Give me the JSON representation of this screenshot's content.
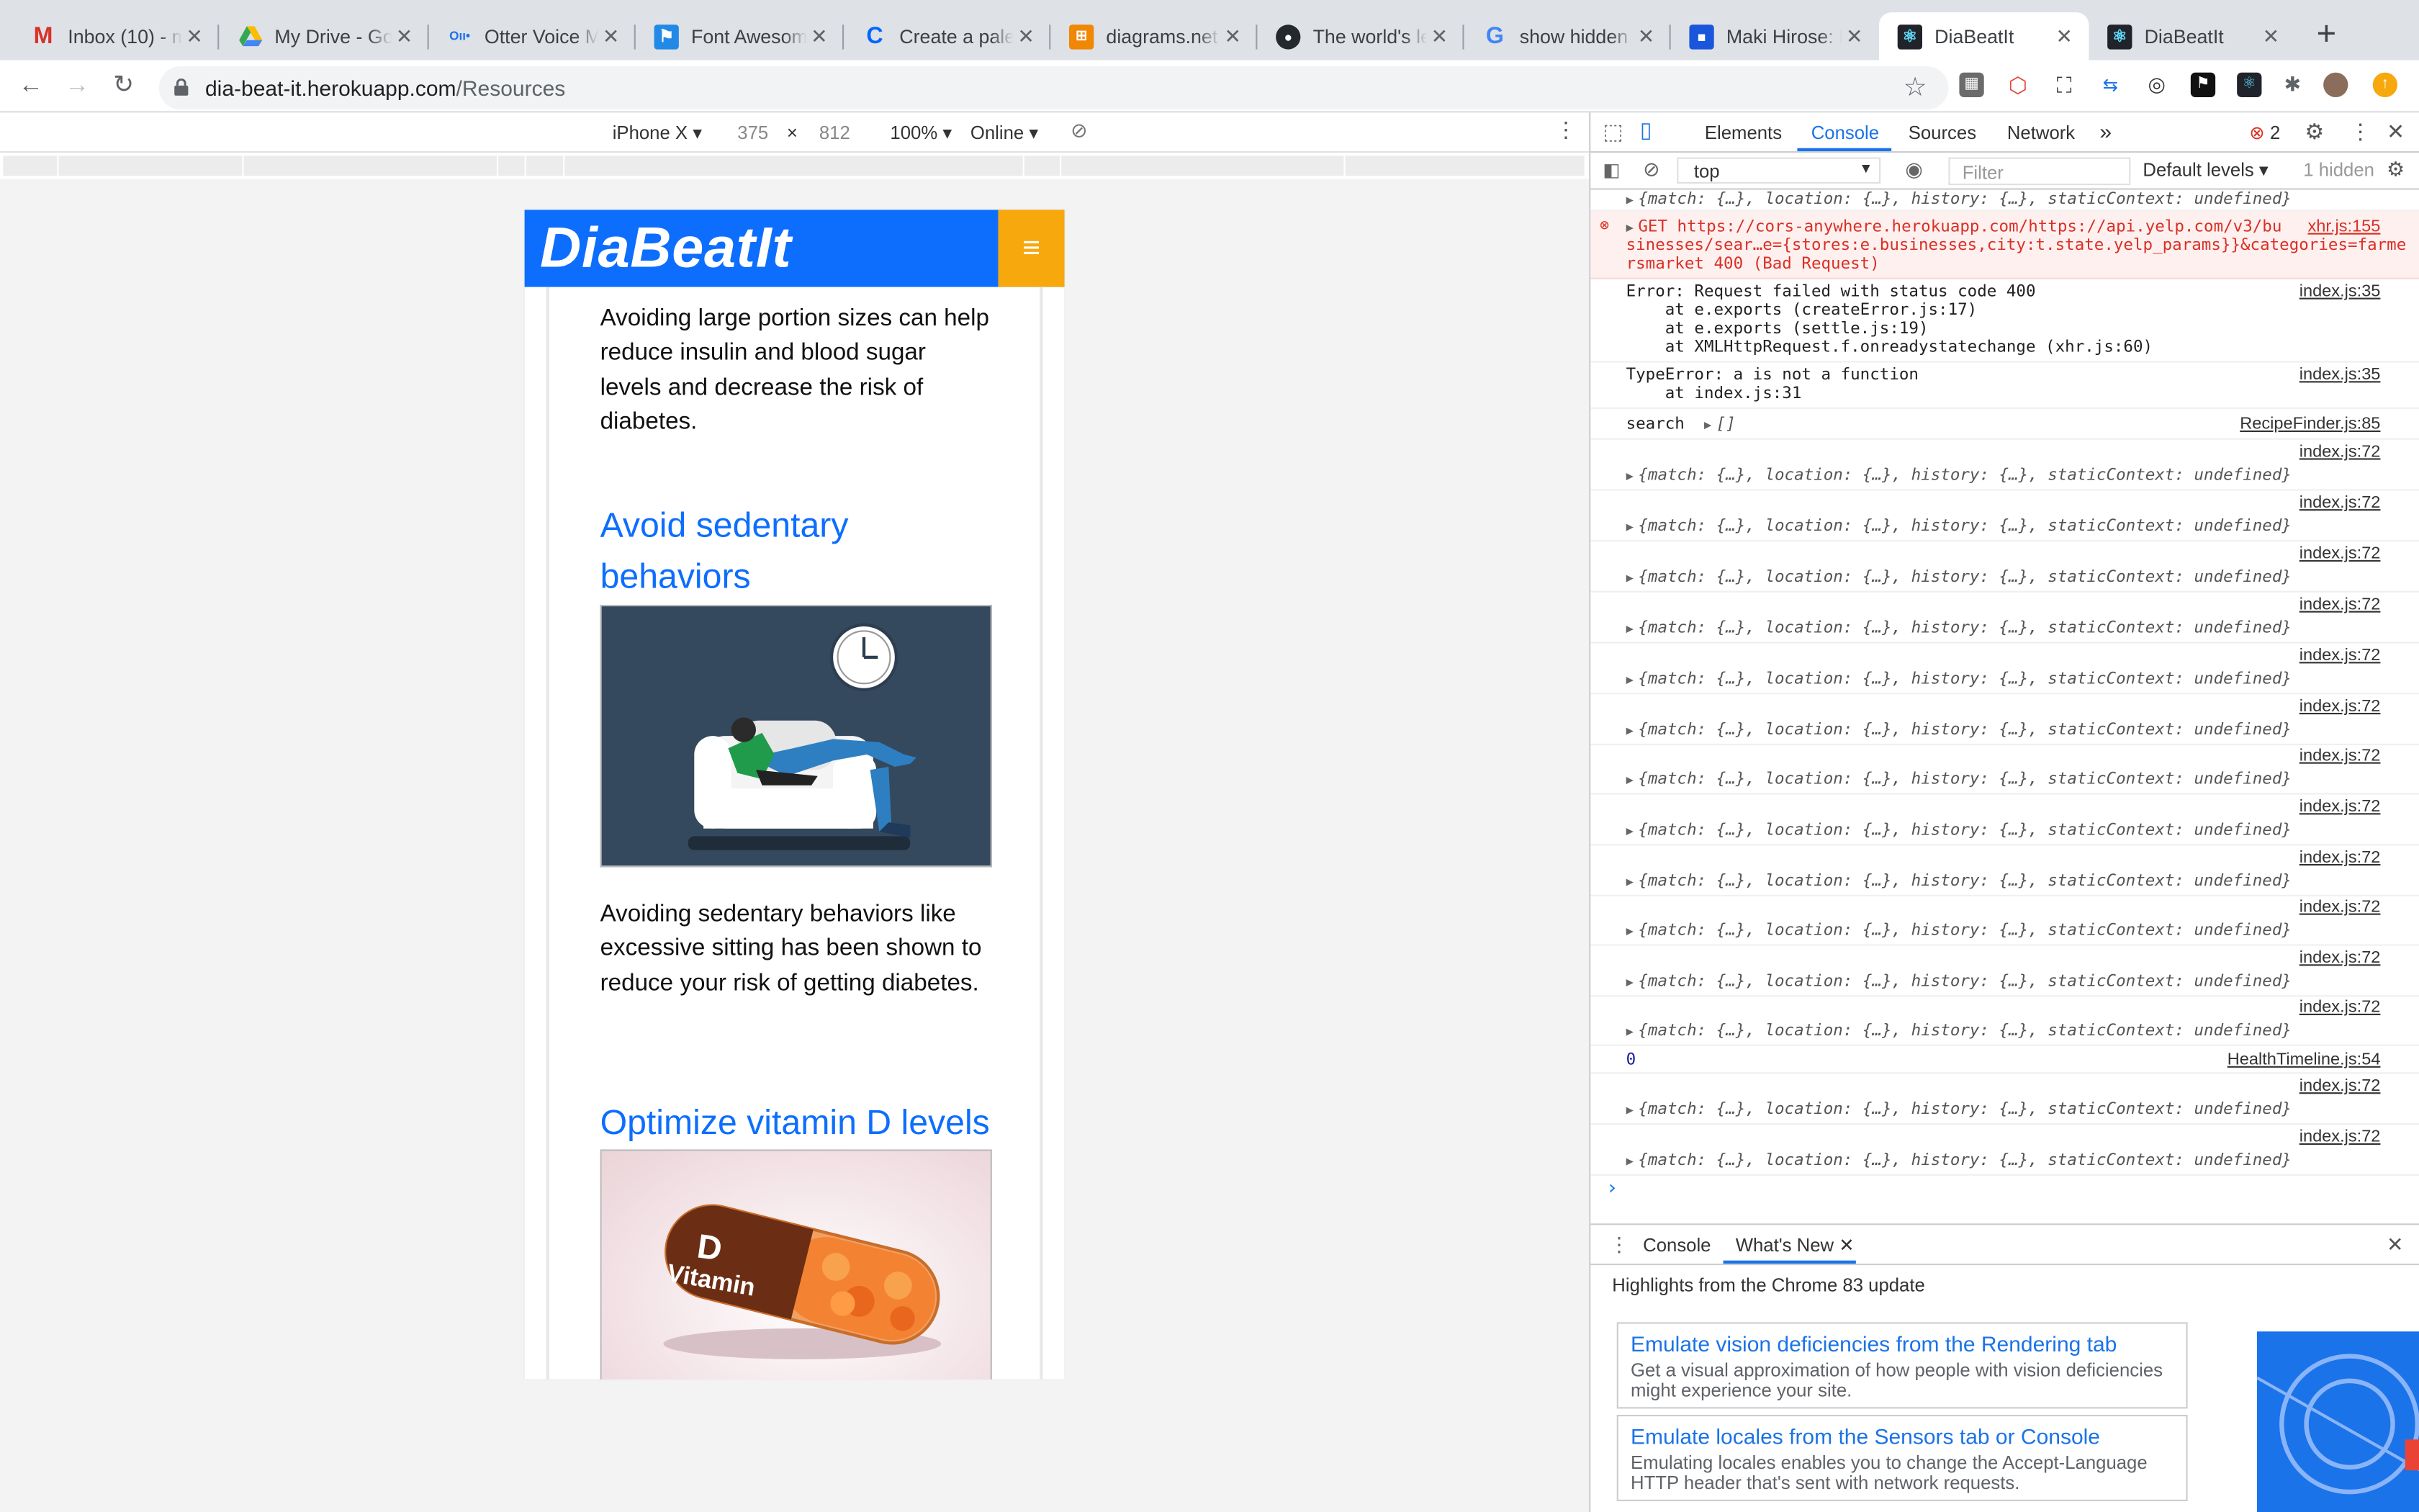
{
  "tabs": [
    {
      "title": "Inbox (10) - m",
      "icon": "gmail-icon"
    },
    {
      "title": "My Drive - Go",
      "icon": "drive-icon"
    },
    {
      "title": "Otter Voice M",
      "icon": "otter-icon"
    },
    {
      "title": "Font Awesome",
      "icon": "fontawesome-icon"
    },
    {
      "title": "Create a palet",
      "icon": "coolors-icon"
    },
    {
      "title": "diagrams.net",
      "icon": "diagrams-icon"
    },
    {
      "title": "The world's le",
      "icon": "github-icon"
    },
    {
      "title": "show hidden f",
      "icon": "google-icon"
    },
    {
      "title": "Maki Hirose: L",
      "icon": "doc-icon"
    },
    {
      "title": "DiaBeatIt",
      "icon": "react-icon"
    },
    {
      "title": "DiaBeatIt",
      "icon": "react-icon"
    }
  ],
  "address": {
    "host": "dia-beat-it.herokuapp.com",
    "path": "/Resources"
  },
  "device": {
    "name": "iPhone X ▾",
    "width": "375",
    "times": "×",
    "height": "812",
    "zoom": "100% ▾",
    "network": "Online ▾"
  },
  "app": {
    "brand": "DiaBeatIt",
    "menu_icon": "≡",
    "para1": "Avoiding large portion sizes can help reduce insulin and blood sugar levels and decrease the risk of diabetes.",
    "heading2": "Avoid sedentary behaviors",
    "para2": "Avoiding sedentary behaviors like excessive sitting has been shown to reduce your risk of getting diabetes.",
    "heading3": "Optimize vitamin D levels",
    "pill_letter": "D",
    "pill_word": "Vitamin"
  },
  "devtools": {
    "tabs": [
      "Elements",
      "Console",
      "Sources",
      "Network",
      "»"
    ],
    "error_count": "2",
    "context": "top",
    "filter_placeholder": "Filter",
    "levels": "Default levels ▾",
    "hidden": "1 hidden",
    "first_line": "{match: {…}, location: {…}, history: {…}, staticContext: undefined}",
    "get_line1": "GET https://cors-anywhere.herokuapp.com/https://api.yelp.com/v3/bu",
    "get_line2": "sinesses/sear…e={stores:e.businesses,city:t.state.yelp_params}}&categories=farme",
    "get_line3": "rsmarket 400 (Bad Request)",
    "get_src": "xhr.js:155",
    "err1": "Error: Request failed with status code 400\n    at e.exports (createError.js:17)\n    at e.exports (settle.js:19)\n    at XMLHttpRequest.f.onreadystatechange (xhr.js:60)",
    "err1_src": "index.js:35",
    "err2": "TypeError: a is not a function\n    at index.js:31",
    "err2_src": "index.js:35",
    "search_label": "search",
    "search_value": "[]",
    "search_src": "RecipeFinder.js:85",
    "repeat_src": "index.js:72",
    "timeline_value": "0",
    "timeline_src": "HealthTimeline.js:54",
    "prompt": "›"
  },
  "drawer": {
    "tabs": [
      "Console",
      "What's New"
    ],
    "headline": "Highlights from the Chrome 83 update",
    "cards": [
      {
        "title": "Emulate vision deficiencies from the Rendering tab",
        "desc": "Get a visual approximation of how people with vision deficiencies might experience your site."
      },
      {
        "title": "Emulate locales from the Sensors tab or Console",
        "desc": "Emulating locales enables you to change the Accept-Language HTTP header that's sent with network requests."
      }
    ]
  }
}
